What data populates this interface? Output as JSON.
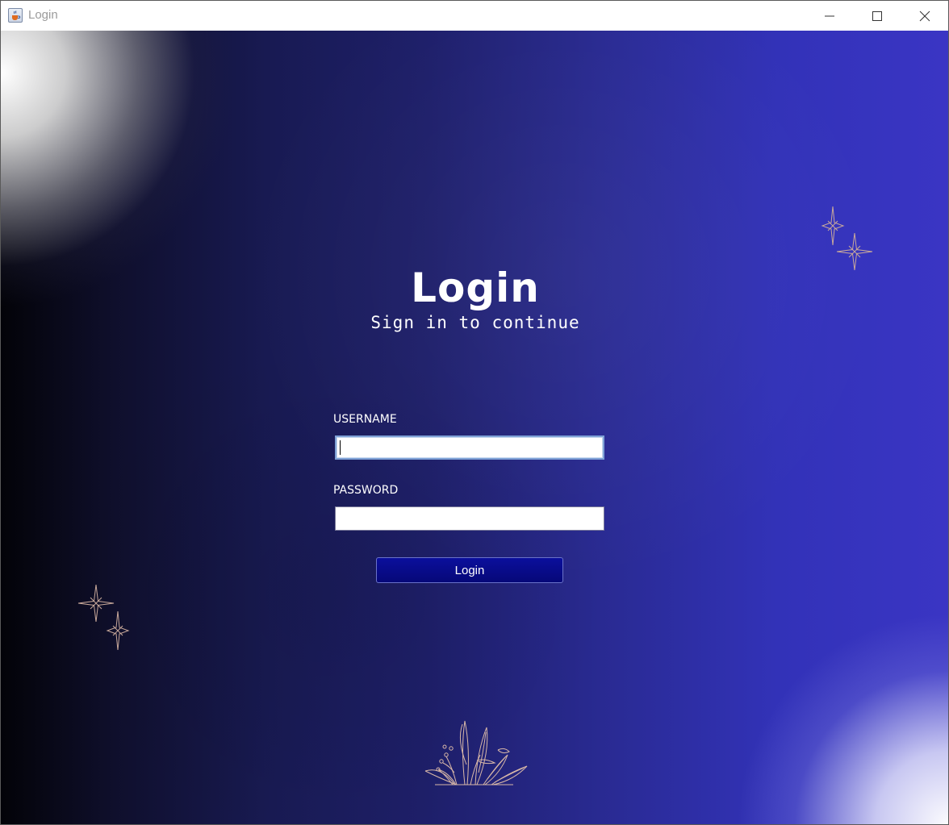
{
  "window": {
    "title": "Login",
    "icon": "java-cup-icon",
    "controls": [
      "minimize-icon",
      "maximize-icon",
      "close-icon"
    ]
  },
  "login": {
    "heading": "Login",
    "subheading": "Sign in to continue",
    "username_label": "USERNAME",
    "username_value": "",
    "password_label": "PASSWORD",
    "password_value": "",
    "submit_label": "Login"
  },
  "colors": {
    "background_dark": "#030308",
    "background_accent": "#3a35c4",
    "button": "#08098a",
    "decoration": "#d9b8a8"
  },
  "decorations": [
    "sparkle-icon",
    "sparkle-icon",
    "sparkle-icon",
    "sparkle-icon",
    "plant-icon"
  ]
}
